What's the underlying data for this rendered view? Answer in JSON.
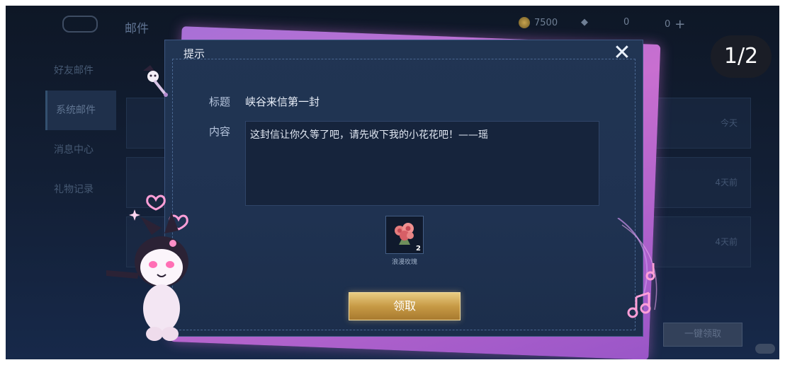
{
  "background": {
    "title": "邮件",
    "resources": [
      {
        "icon": "coin-icon",
        "value": "7500"
      },
      {
        "icon": "diamond-icon",
        "value": "0"
      },
      {
        "icon": "ticket-icon",
        "value": "0"
      }
    ],
    "left_menu": [
      {
        "label": "好友邮件",
        "active": false
      },
      {
        "label": "系统邮件",
        "active": true
      },
      {
        "label": "消息中心",
        "active": false
      },
      {
        "label": "礼物记录",
        "active": false
      }
    ],
    "rows": [
      {
        "meta": "今天"
      },
      {
        "meta": "4天前"
      },
      {
        "meta": "4天前"
      }
    ],
    "claim_all_label": "一键领取"
  },
  "page_indicator": "1/2",
  "dialog": {
    "title": "提示",
    "subject_label": "标题",
    "subject": "峡谷来信第一封",
    "content_label": "内容",
    "content": "这封信让你久等了吧，请先收下我的小花花吧！——瑶",
    "reward": {
      "icon": "rose-bouquet-icon",
      "count": "2",
      "name": "浪漫玫瑰"
    },
    "claim_label": "领取"
  },
  "colors": {
    "accent_gold": "#c79a45",
    "dialog_bg": "#213553",
    "pink_card": "#c86fd0"
  }
}
